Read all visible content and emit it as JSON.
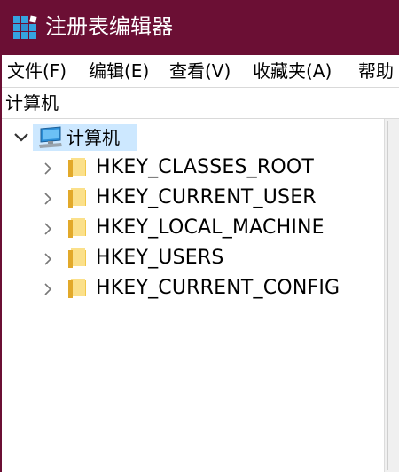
{
  "window": {
    "title": "注册表编辑器",
    "app_icon": "regedit-icon",
    "accent_color": "#6b0f34"
  },
  "menu": {
    "items": [
      {
        "label": "文件(F)"
      },
      {
        "label": "编辑(E)"
      },
      {
        "label": "查看(V)"
      },
      {
        "label": "收藏夹(A)"
      },
      {
        "label": "帮助"
      }
    ]
  },
  "address": {
    "path": "计算机"
  },
  "tree": {
    "root": {
      "label": "计算机",
      "icon": "computer-icon",
      "expanded": true,
      "selected": true
    },
    "hives": [
      {
        "label": "HKEY_CLASSES_ROOT",
        "icon": "folder-icon",
        "expanded": false
      },
      {
        "label": "HKEY_CURRENT_USER",
        "icon": "folder-icon",
        "expanded": false
      },
      {
        "label": "HKEY_LOCAL_MACHINE",
        "icon": "folder-icon",
        "expanded": false
      },
      {
        "label": "HKEY_USERS",
        "icon": "folder-icon",
        "expanded": false
      },
      {
        "label": "HKEY_CURRENT_CONFIG",
        "icon": "folder-icon",
        "expanded": false
      }
    ]
  }
}
